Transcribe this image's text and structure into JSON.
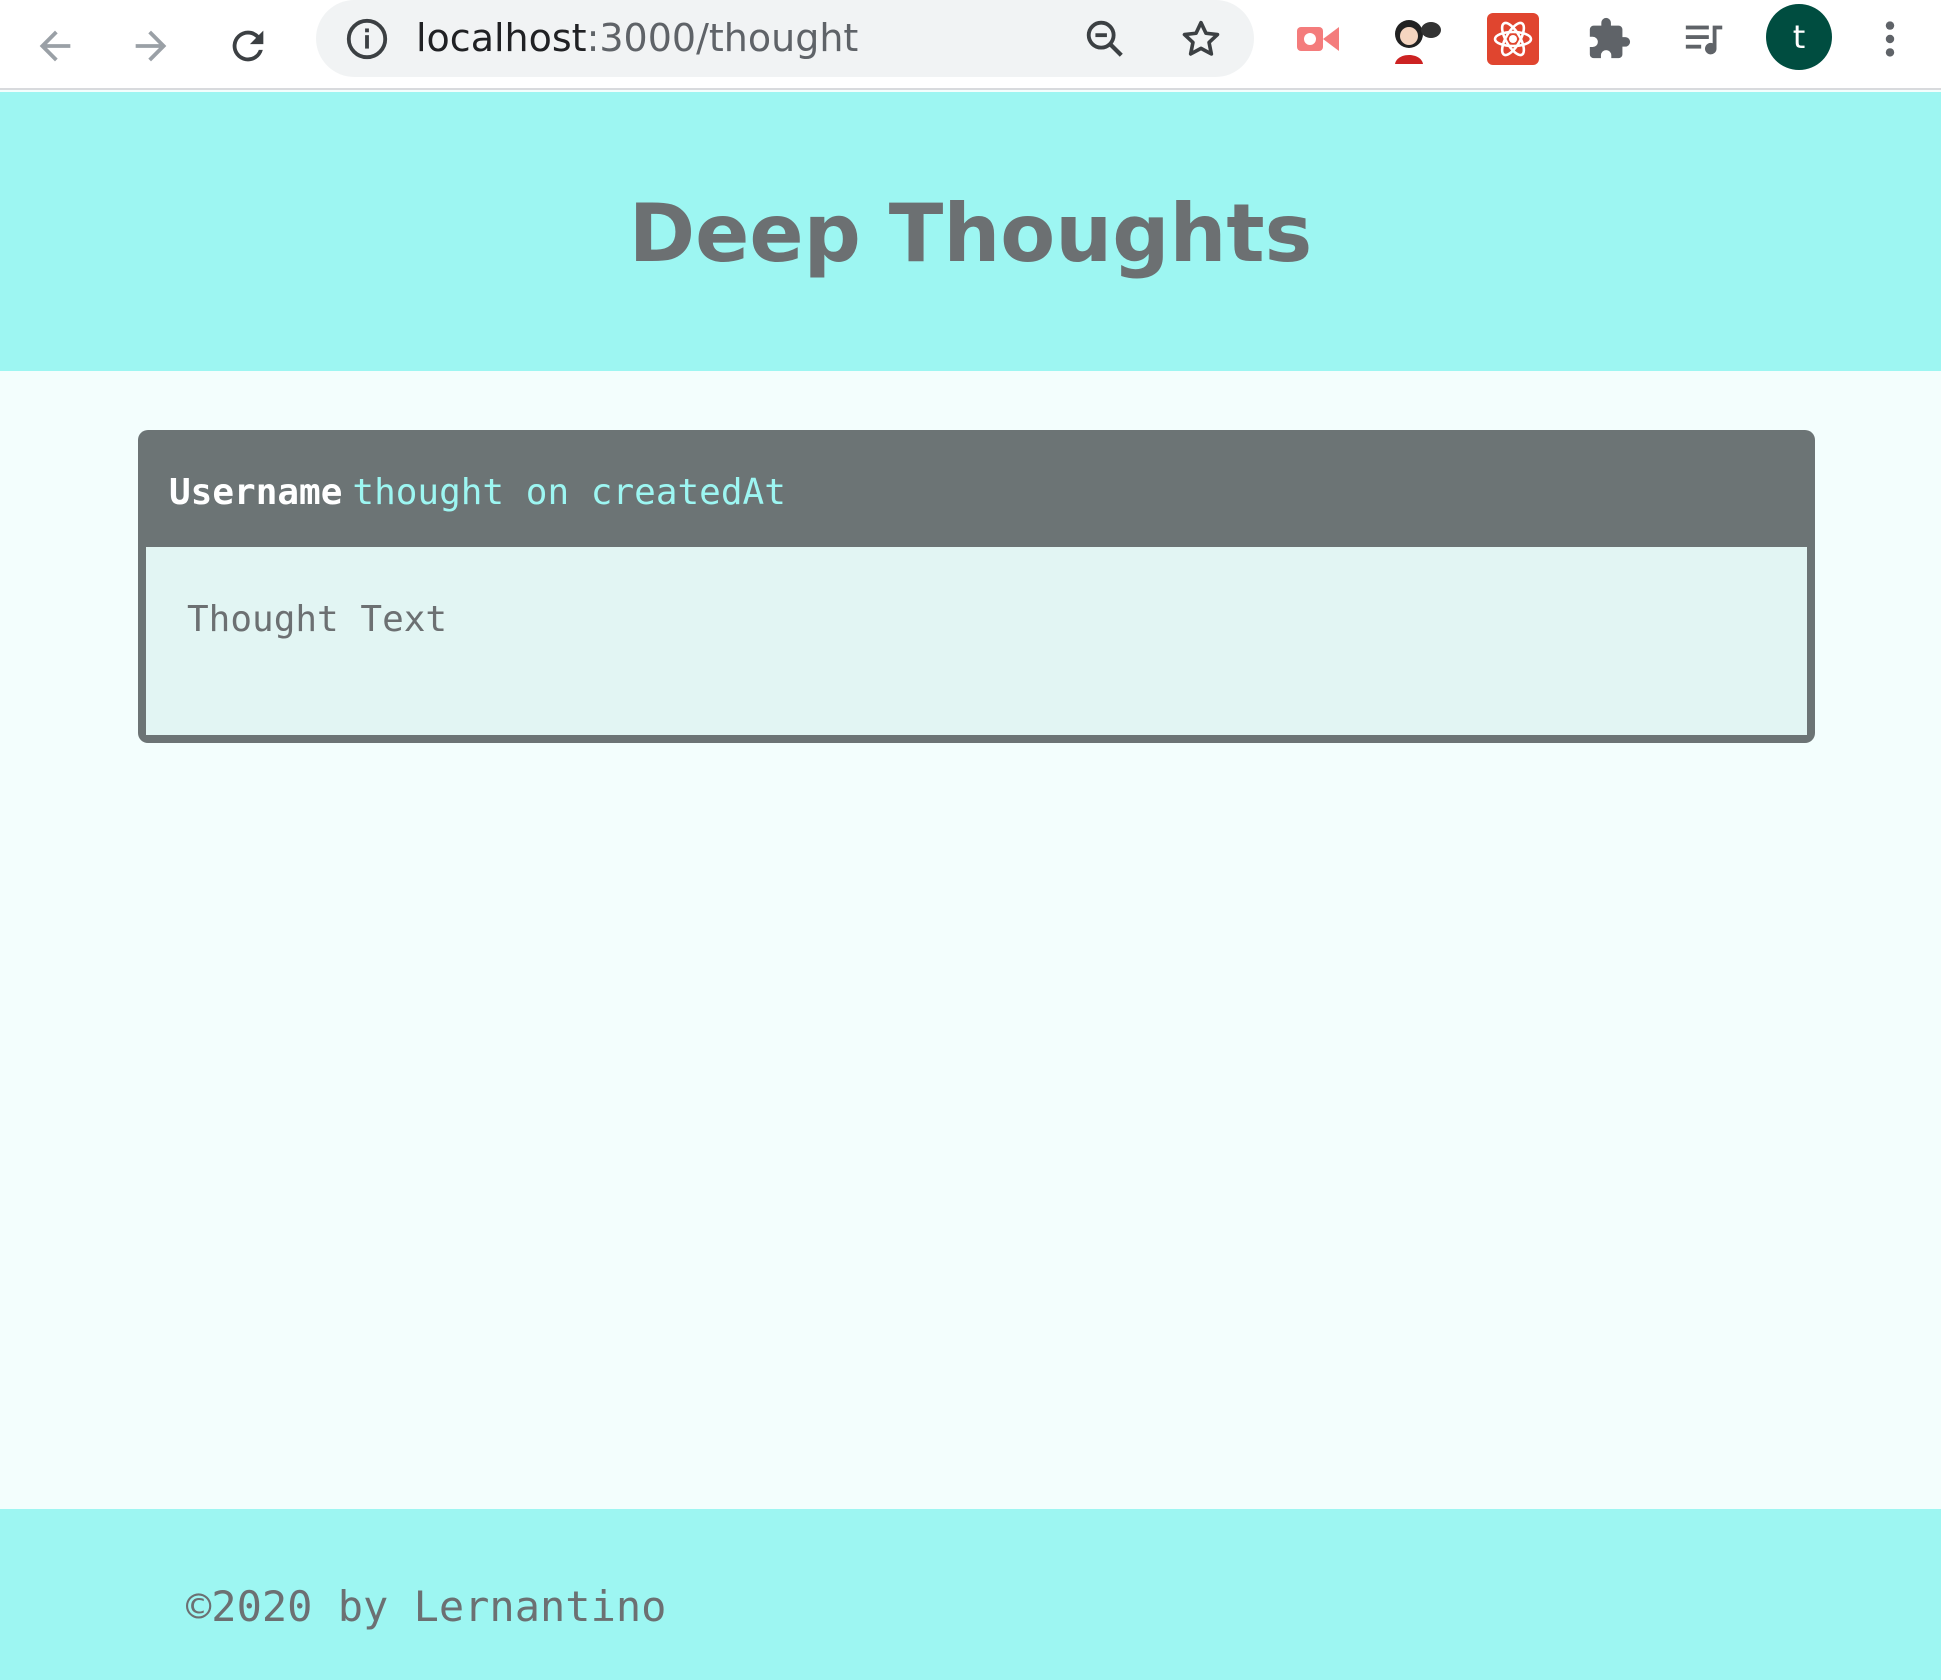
{
  "browser": {
    "url_host": "localhost",
    "url_path": ":3000/thought",
    "profile_initial": "t",
    "icons": [
      "back-arrow-icon",
      "forward-arrow-icon",
      "reload-icon",
      "site-info-icon",
      "zoom-out-icon",
      "bookmark-star-icon",
      "video-extension-icon",
      "avatar-extension-icon",
      "react-devtools-icon",
      "extensions-puzzle-icon",
      "media-queue-icon",
      "menu-dots-icon"
    ]
  },
  "header": {
    "title": "Deep Thoughts"
  },
  "thought": {
    "username": "Username",
    "meta": "thought on createdAt",
    "text": "Thought Text"
  },
  "footer": {
    "text": "©2020 by Lernantino"
  },
  "colors": {
    "header_bg": "#9df6f2",
    "page_bg": "#f3fefd",
    "card_bg": "#6c7475",
    "card_body_bg": "#e2f5f3",
    "accent_text": "#9df6f2",
    "title_text": "#6c7072"
  }
}
